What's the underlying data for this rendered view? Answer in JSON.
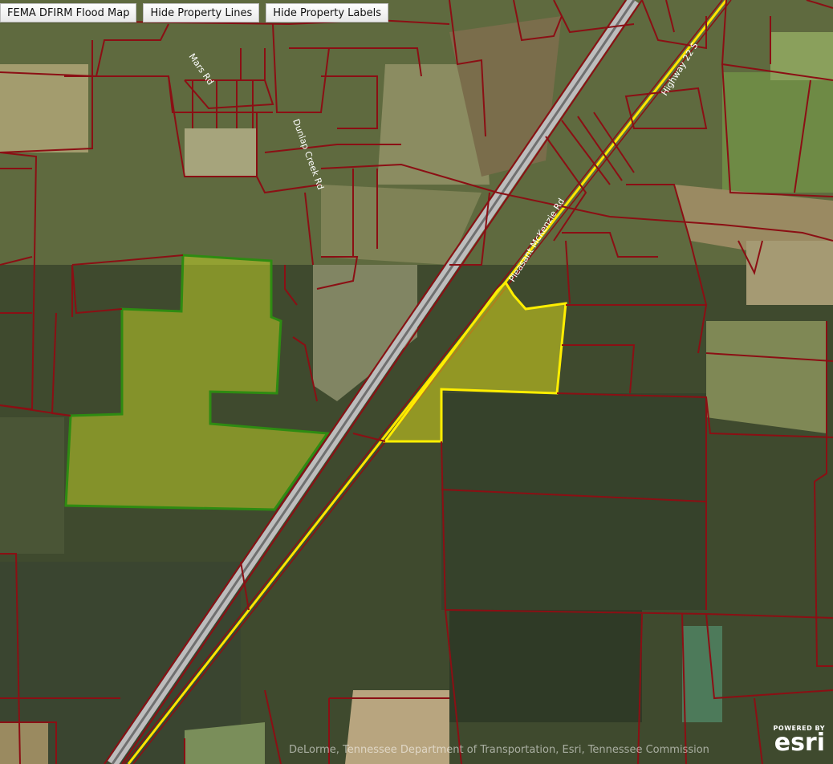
{
  "toolbar": {
    "flood_map_label": "FEMA DFIRM Flood Map",
    "hide_lines_label": "Hide Property Lines",
    "hide_labels_label": "Hide Property Labels"
  },
  "labels": {
    "highway": "Highway 22 S",
    "road_mckenzie": "Pleasant McKenzie Rd",
    "road_ne1": "Dunlap Creek Rd",
    "road_ne2": "Mars Rd"
  },
  "attribution": "DeLorme, Tennessee Department of Transportation, Esri, Tennessee Commission",
  "esri": {
    "powered_by": "POWERED BY",
    "logo": "esri"
  },
  "colors": {
    "parcel_line": "#8b0f14",
    "green_highlight": "#2e8b12",
    "yellow_highlight": "#ffee00"
  }
}
